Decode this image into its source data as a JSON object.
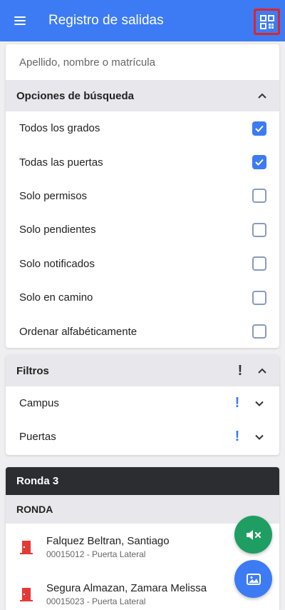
{
  "appbar": {
    "title": "Registro de salidas",
    "menu_icon": "hamburger-icon",
    "qr_icon": "qr-code-icon",
    "accent": "#3d7bf5",
    "highlight": "#e02424"
  },
  "search": {
    "placeholder": "Apellido, nombre o matrícula",
    "value": ""
  },
  "options": {
    "header": "Opciones de búsqueda",
    "expanded": true,
    "items": [
      {
        "label": "Todos los grados",
        "checked": true
      },
      {
        "label": "Todas las puertas",
        "checked": true
      },
      {
        "label": "Solo permisos",
        "checked": false
      },
      {
        "label": "Solo pendientes",
        "checked": false
      },
      {
        "label": "Solo notificados",
        "checked": false
      },
      {
        "label": "Solo en camino",
        "checked": false
      },
      {
        "label": "Ordenar alfabéticamente",
        "checked": false
      }
    ]
  },
  "filters": {
    "header": "Filtros",
    "header_alert": "!",
    "items": [
      {
        "label": "Campus",
        "alert": "!"
      },
      {
        "label": "Puertas",
        "alert": "!"
      }
    ]
  },
  "ronda": {
    "title": "Ronda 3",
    "subheader": "RONDA",
    "students": [
      {
        "name": "Falquez Beltran, Santiago",
        "meta": "00015012 - Puerta Lateral"
      },
      {
        "name": "Segura Almazan, Zamara Melissa",
        "meta": "00015023 - Puerta Lateral"
      }
    ]
  },
  "fabs": {
    "mute_icon": "speaker-mute-icon",
    "image_icon": "image-icon"
  }
}
